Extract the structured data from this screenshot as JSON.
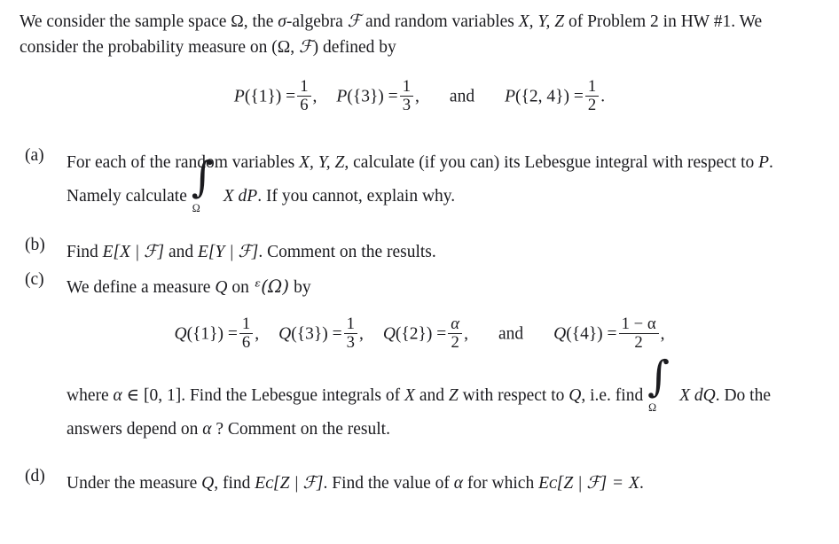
{
  "document": {
    "type": "math-problem-set",
    "text_color": "#1b1b1f",
    "background_color": "#ffffff"
  },
  "intro": {
    "line1_part1": "We consider the sample space ",
    "omega": "Ω",
    "line1_part2": ", the ",
    "sigma": "σ",
    "line1_part3": "-algebra ",
    "script_f": "ℱ",
    "line1_part4": " and random variables ",
    "vars": "X, Y, Z",
    "line1_part5": " of Problem 2 in HW #1. We consider the probability measure on (",
    "line1_part6": ", ",
    "line1_part7": ") defined by"
  },
  "equation_p": {
    "name": "probability-measure-definition",
    "terms": [
      {
        "lhs": "P({1}) =",
        "num": "1",
        "den": "6",
        "trail": ","
      },
      {
        "lhs": "P({3}) =",
        "num": "1",
        "den": "3",
        "trail": ","
      },
      {
        "lhs": "P({2, 4}) =",
        "num": "1",
        "den": "2",
        "trail": "."
      }
    ],
    "conjunction": "and",
    "P": "P",
    "set1": "({1}) =",
    "set3": "({3}) =",
    "set24": "({2, 4}) ="
  },
  "equation_q": {
    "name": "measure-q-definition",
    "Q": "Q",
    "set1": "({1}) =",
    "set3": "({3}) =",
    "set2": "({2}) =",
    "set4": "({4}) =",
    "frac1_num": "1",
    "frac1_den": "6",
    "frac2_num": "1",
    "frac2_den": "3",
    "frac3_num": "α",
    "frac3_den": "2",
    "frac4_num": "1 − α",
    "frac4_den": "2",
    "comma": ",",
    "conjunction": "and"
  },
  "items": [
    {
      "marker": "(a)",
      "id": "item-a",
      "segments": {
        "s1": "For each of the random variables ",
        "vars": "X, Y, Z",
        "s2": ", calculate (if you can) its Lebesgue integral with respect to ",
        "P": "P",
        "s3": ". Namely calculate ",
        "integrand": "X dP",
        "integral_limit": "Ω",
        "s4": ". If you cannot, explain why."
      }
    },
    {
      "marker": "(b)",
      "id": "item-b",
      "segments": {
        "s1": "Find ",
        "expr1": "E[X | ℱ]",
        "s2": " and ",
        "expr2": "E[Y | ℱ]",
        "s3": ". Comment on the results."
      }
    },
    {
      "marker": "(c)",
      "id": "item-c",
      "segments": {
        "s1": "We define a measure ",
        "Q": "Q",
        "s2": " on ",
        "powerset": "ᵋ(Ω)",
        "s3": " by"
      }
    },
    {
      "marker": "(d)",
      "id": "item-d",
      "segments": {
        "s1": "Under the measure ",
        "Q": "Q",
        "s2": ", find ",
        "expr1": "Eᴄ[Z | ℱ]",
        "s3": ". Find the value of ",
        "alpha": "α",
        "s4": " for which ",
        "expr2": "Eᴄ[Z | ℱ]",
        "s5": " = ",
        "X": "X",
        "s6": "."
      }
    }
  ],
  "where_paragraph": {
    "s1": "where ",
    "alpha": "α",
    "s2": " ∈ [0, 1]. Find the Lebesgue integrals of ",
    "X": "X",
    "s3": " and ",
    "Z": "Z",
    "s4": " with respect to ",
    "Q": "Q",
    "s5": ", i.e. find ",
    "integrand": "X dQ",
    "integral_limit": "Ω",
    "s6": ". Do the answers depend on ",
    "s7": " ? Comment on the result."
  }
}
